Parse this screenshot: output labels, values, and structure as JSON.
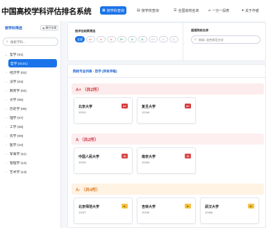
{
  "app": {
    "title": "中国高校学科评估排名系统"
  },
  "nav": [
    {
      "label": "按学科查询",
      "icon": "grid-icon",
      "active": true
    },
    {
      "label": "按学校查询",
      "icon": "building-icon",
      "active": false
    },
    {
      "label": "全国高校名单",
      "icon": "list-icon",
      "active": false
    },
    {
      "label": "一分一段表",
      "icon": "chart-icon",
      "active": false
    },
    {
      "label": "关于作者",
      "icon": "user-icon",
      "active": false
    }
  ],
  "sidebar": {
    "heading": "按学科筛选",
    "expand_label": "展开全部",
    "search_placeholder": "搜索学科...",
    "items": [
      {
        "label": "哲学 (01)",
        "expanded": true
      },
      {
        "label": "哲学 (0101)",
        "sub": true,
        "active": true
      },
      {
        "label": "经济学 (02)"
      },
      {
        "label": "法学 (03)"
      },
      {
        "label": "教育学 (04)"
      },
      {
        "label": "文学 (05)"
      },
      {
        "label": "历史学 (06)"
      },
      {
        "label": "理学 (07)"
      },
      {
        "label": "工学 (08)"
      },
      {
        "label": "农学 (09)"
      },
      {
        "label": "医学 (10)"
      },
      {
        "label": "军事学 (11)"
      },
      {
        "label": "管理学 (12)"
      },
      {
        "label": "艺术学 (13)"
      }
    ]
  },
  "filter": {
    "grade_title": "按评估结果筛选",
    "grades": [
      "全部",
      "A+",
      "A",
      "A-",
      "B+",
      "B",
      "B-",
      "C+",
      "C",
      "C-"
    ],
    "search_title": "搜索院校名称",
    "search_placeholder": "例如: 北京师范大学"
  },
  "results": {
    "title": "院校专业列表 - 哲学 (所有评级)",
    "groups": [
      {
        "heading": "A+ （共2所）",
        "universities": [
          {
            "name": "北京大学",
            "code": "10001",
            "grade": "A+"
          },
          {
            "name": "复旦大学",
            "code": "10246",
            "grade": "A+"
          }
        ]
      },
      {
        "heading": "A （共2所）",
        "universities": [
          {
            "name": "中国人民大学",
            "code": "10002",
            "grade": "A"
          },
          {
            "name": "南京大学",
            "code": "10284",
            "grade": "A"
          }
        ]
      },
      {
        "heading": "A- （共4所）",
        "universities": [
          {
            "name": "北京师范大学",
            "code": "10027",
            "grade": "A-"
          },
          {
            "name": "吉林大学",
            "code": "10183",
            "grade": "A-"
          },
          {
            "name": "武汉大学",
            "code": "10486",
            "grade": "A-"
          }
        ]
      }
    ]
  }
}
